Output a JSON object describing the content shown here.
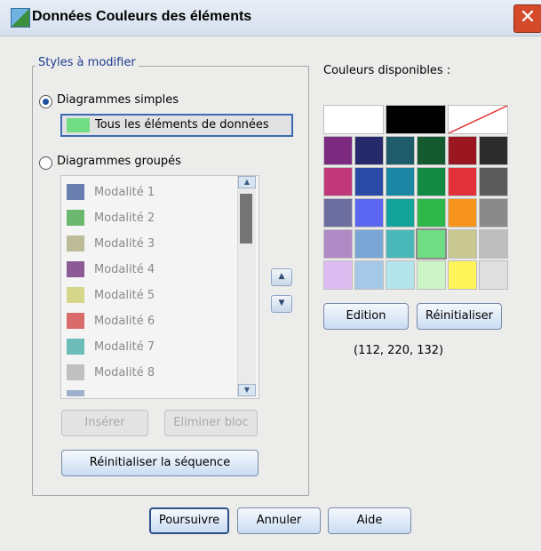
{
  "window": {
    "title": "Données Couleurs des éléments",
    "close_glyph": "✕",
    "icon": "chart-app-icon"
  },
  "styles_group": {
    "legend": "Styles à modifier",
    "simple_radio_label": "Diagrammes simples",
    "simple_selected_item": {
      "label": "Tous les éléments de données",
      "color": "#70dc84"
    },
    "grouped_radio_label": "Diagrammes groupés",
    "selected_mode": "simple",
    "categories": [
      {
        "label": "Modalité 1",
        "color": "#6b7eb0"
      },
      {
        "label": "Modalité 2",
        "color": "#6db86f"
      },
      {
        "label": "Modalité 3",
        "color": "#bcbc98"
      },
      {
        "label": "Modalité 4",
        "color": "#8c5a94"
      },
      {
        "label": "Modalité 5",
        "color": "#d6d68a"
      },
      {
        "label": "Modalité 6",
        "color": "#d96b6b"
      },
      {
        "label": "Modalité 7",
        "color": "#6cbcb8"
      },
      {
        "label": "Modalité 8",
        "color": "#c0c0c0"
      }
    ],
    "insert_button": "Insérer",
    "remove_button": "Eliminer bloc",
    "reset_sequence_button": "Réinitialiser la séquence"
  },
  "palette": {
    "label": "Couleurs disponibles :",
    "rows": [
      [
        "#ffffff",
        "#000000",
        "none"
      ],
      [
        "#7b2a7f",
        "#262a6b",
        "#1e5c6a",
        "#145a2f",
        "#9a1722",
        "#2c2c2c"
      ],
      [
        "#c0387a",
        "#2b4aa6",
        "#1c87a5",
        "#128a43",
        "#e2313a",
        "#5a5a5a"
      ],
      [
        "#6b6e9e",
        "#5a66f0",
        "#14a39a",
        "#2eb84c",
        "#f7941d",
        "#8a8a8a"
      ],
      [
        "#b08ac4",
        "#7aa6d6",
        "#4ab8b8",
        "#70dc84",
        "#c8c890",
        "#bdbdbd"
      ],
      [
        "#dcbcf0",
        "#a6c8e8",
        "#b4e4ec",
        "#cdf5c8",
        "#fff45a",
        "#e0e0e0"
      ]
    ],
    "selected": "#70dc84",
    "edit_button": "Edition",
    "reset_button": "Réinitialiser",
    "rgb_readout": "(112, 220, 132)"
  },
  "footer": {
    "continue_button": "Poursuivre",
    "cancel_button": "Annuler",
    "help_button": "Aide"
  }
}
